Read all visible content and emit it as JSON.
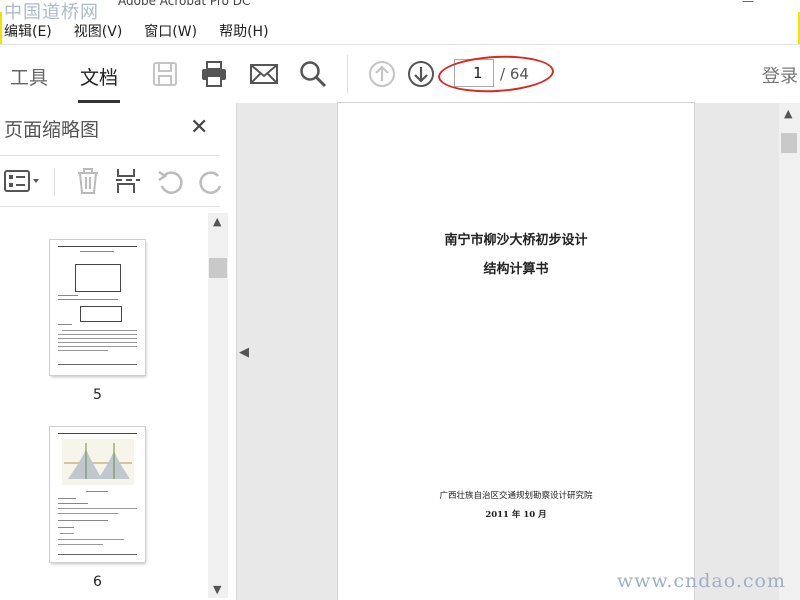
{
  "app": {
    "title_fragment": "Adobe Acrobat Pro DC"
  },
  "watermark": {
    "top": "中国道桥网",
    "bottom": "www.cndao.com"
  },
  "menu": [
    "编辑(E)",
    "视图(V)",
    "窗口(W)",
    "帮助(H)"
  ],
  "toolbar": {
    "tab_tools": "工具",
    "tab_document": "文档",
    "page_current": "1",
    "page_total": "/ 64",
    "login": "登录",
    "icons": [
      "save-icon",
      "print-icon",
      "email-icon",
      "search-icon",
      "page-up-icon",
      "page-down-icon"
    ]
  },
  "panel": {
    "title": "页面缩略图",
    "thumbnails": [
      {
        "label": "5"
      },
      {
        "label": "6"
      }
    ]
  },
  "document": {
    "title": "南宁市柳沙大桥初步设计",
    "subtitle": "结构计算书",
    "organization": "广西壮族自治区交通规划勘察设计研究院",
    "date": "2011 年 10 月"
  },
  "colors": {
    "annotation_red": "#d8281f",
    "frame_yellow": "#f2e600"
  }
}
